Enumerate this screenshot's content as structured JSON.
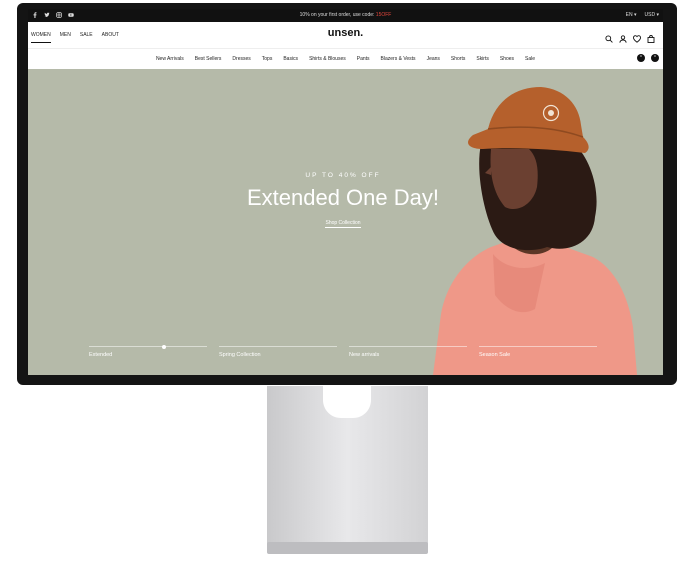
{
  "topbar": {
    "promo_text": "10% on your first order, use code:",
    "promo_code": "15OFF",
    "language": "EN",
    "currency": "USD"
  },
  "header": {
    "logo": "unsen.",
    "primary_nav": [
      "WOMEN",
      "MEN",
      "SALE",
      "ABOUT"
    ],
    "wishlist_count": "0",
    "cart_count": "0"
  },
  "categories": [
    "New Arrivals",
    "Best Sellers",
    "Dresses",
    "Tops",
    "Basics",
    "Shirts & Blouses",
    "Pants",
    "Blazers & Vests",
    "Jeans",
    "Shorts",
    "Skirts",
    "Shoes",
    "Sale"
  ],
  "hero": {
    "eyebrow": "UP TO 40% OFF",
    "title": "Extended One Day!",
    "cta": "Shop Collection",
    "slides": [
      "Extended",
      "Spring Collection",
      "New arrivals",
      "Season Sale"
    ]
  },
  "colors": {
    "hero_bg": "#b5baa9",
    "topbar_bg": "#111111",
    "promo_code": "#e2463c",
    "shirt": "#ef9888",
    "hat": "#b5602c",
    "bezel": "#141414"
  }
}
